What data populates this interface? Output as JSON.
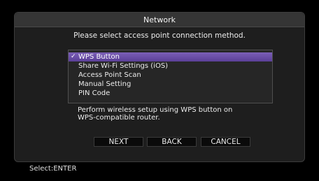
{
  "dialog": {
    "title": "Network",
    "prompt": "Please select access point connection method.",
    "menu": {
      "items": [
        {
          "label": "WPS Button",
          "selected": true
        },
        {
          "label": "Share Wi-Fi Settings (iOS)",
          "selected": false
        },
        {
          "label": "Access Point Scan",
          "selected": false
        },
        {
          "label": "Manual Setting",
          "selected": false
        },
        {
          "label": "PIN Code",
          "selected": false
        }
      ],
      "check_glyph": "✓"
    },
    "description_lines": [
      "Perform wireless setup using WPS button on",
      "WPS-compatible router."
    ],
    "buttons": {
      "next": "NEXT",
      "back": "BACK",
      "cancel": "CANCEL"
    }
  },
  "footer": {
    "hint": "Select:ENTER"
  },
  "colors": {
    "background": "#000000",
    "panel": "#1e1e1e",
    "title_bar": "#353535",
    "selected_item": "#6b4fa7",
    "text": "#ececec"
  }
}
